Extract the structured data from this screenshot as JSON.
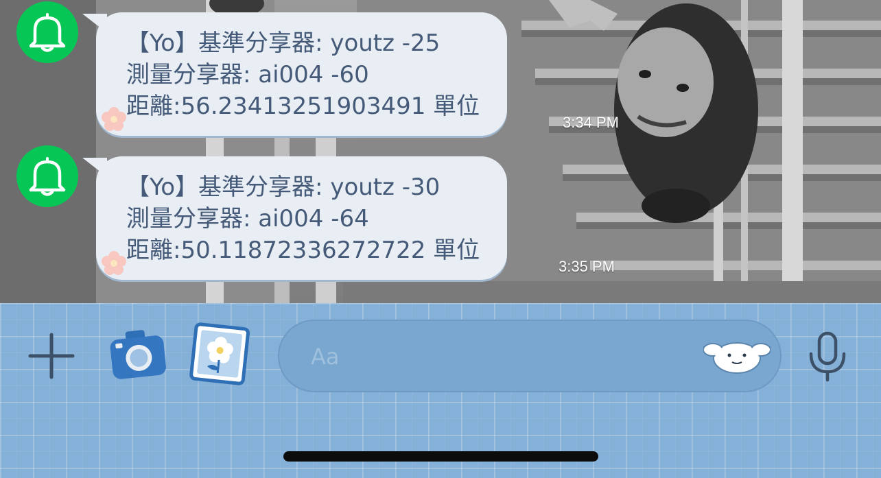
{
  "messages": [
    {
      "sender_icon": "bell-icon",
      "lines": [
        "【Yo】基準分享器: youtz -25",
        "測量分享器: ai004 -60",
        "距離:56.23413251903491 單位"
      ],
      "time": "3:34 PM"
    },
    {
      "sender_icon": "bell-icon",
      "lines": [
        "【Yo】基準分享器: youtz -30",
        "測量分享器: ai004 -64",
        "距離:50.11872336272722 單位"
      ],
      "time": "3:35 PM"
    }
  ],
  "input": {
    "placeholder": "Aa",
    "value": ""
  },
  "toolbar_icons": [
    "plus-icon",
    "camera-icon",
    "photo-icon",
    "sticker-icon",
    "microphone-icon"
  ],
  "colors": {
    "avatar": "#06c755",
    "bubble": "#e8eef3",
    "bubble_text": "#455a78",
    "toolbar": "#85b0d7",
    "input": "#7aa7cf"
  }
}
